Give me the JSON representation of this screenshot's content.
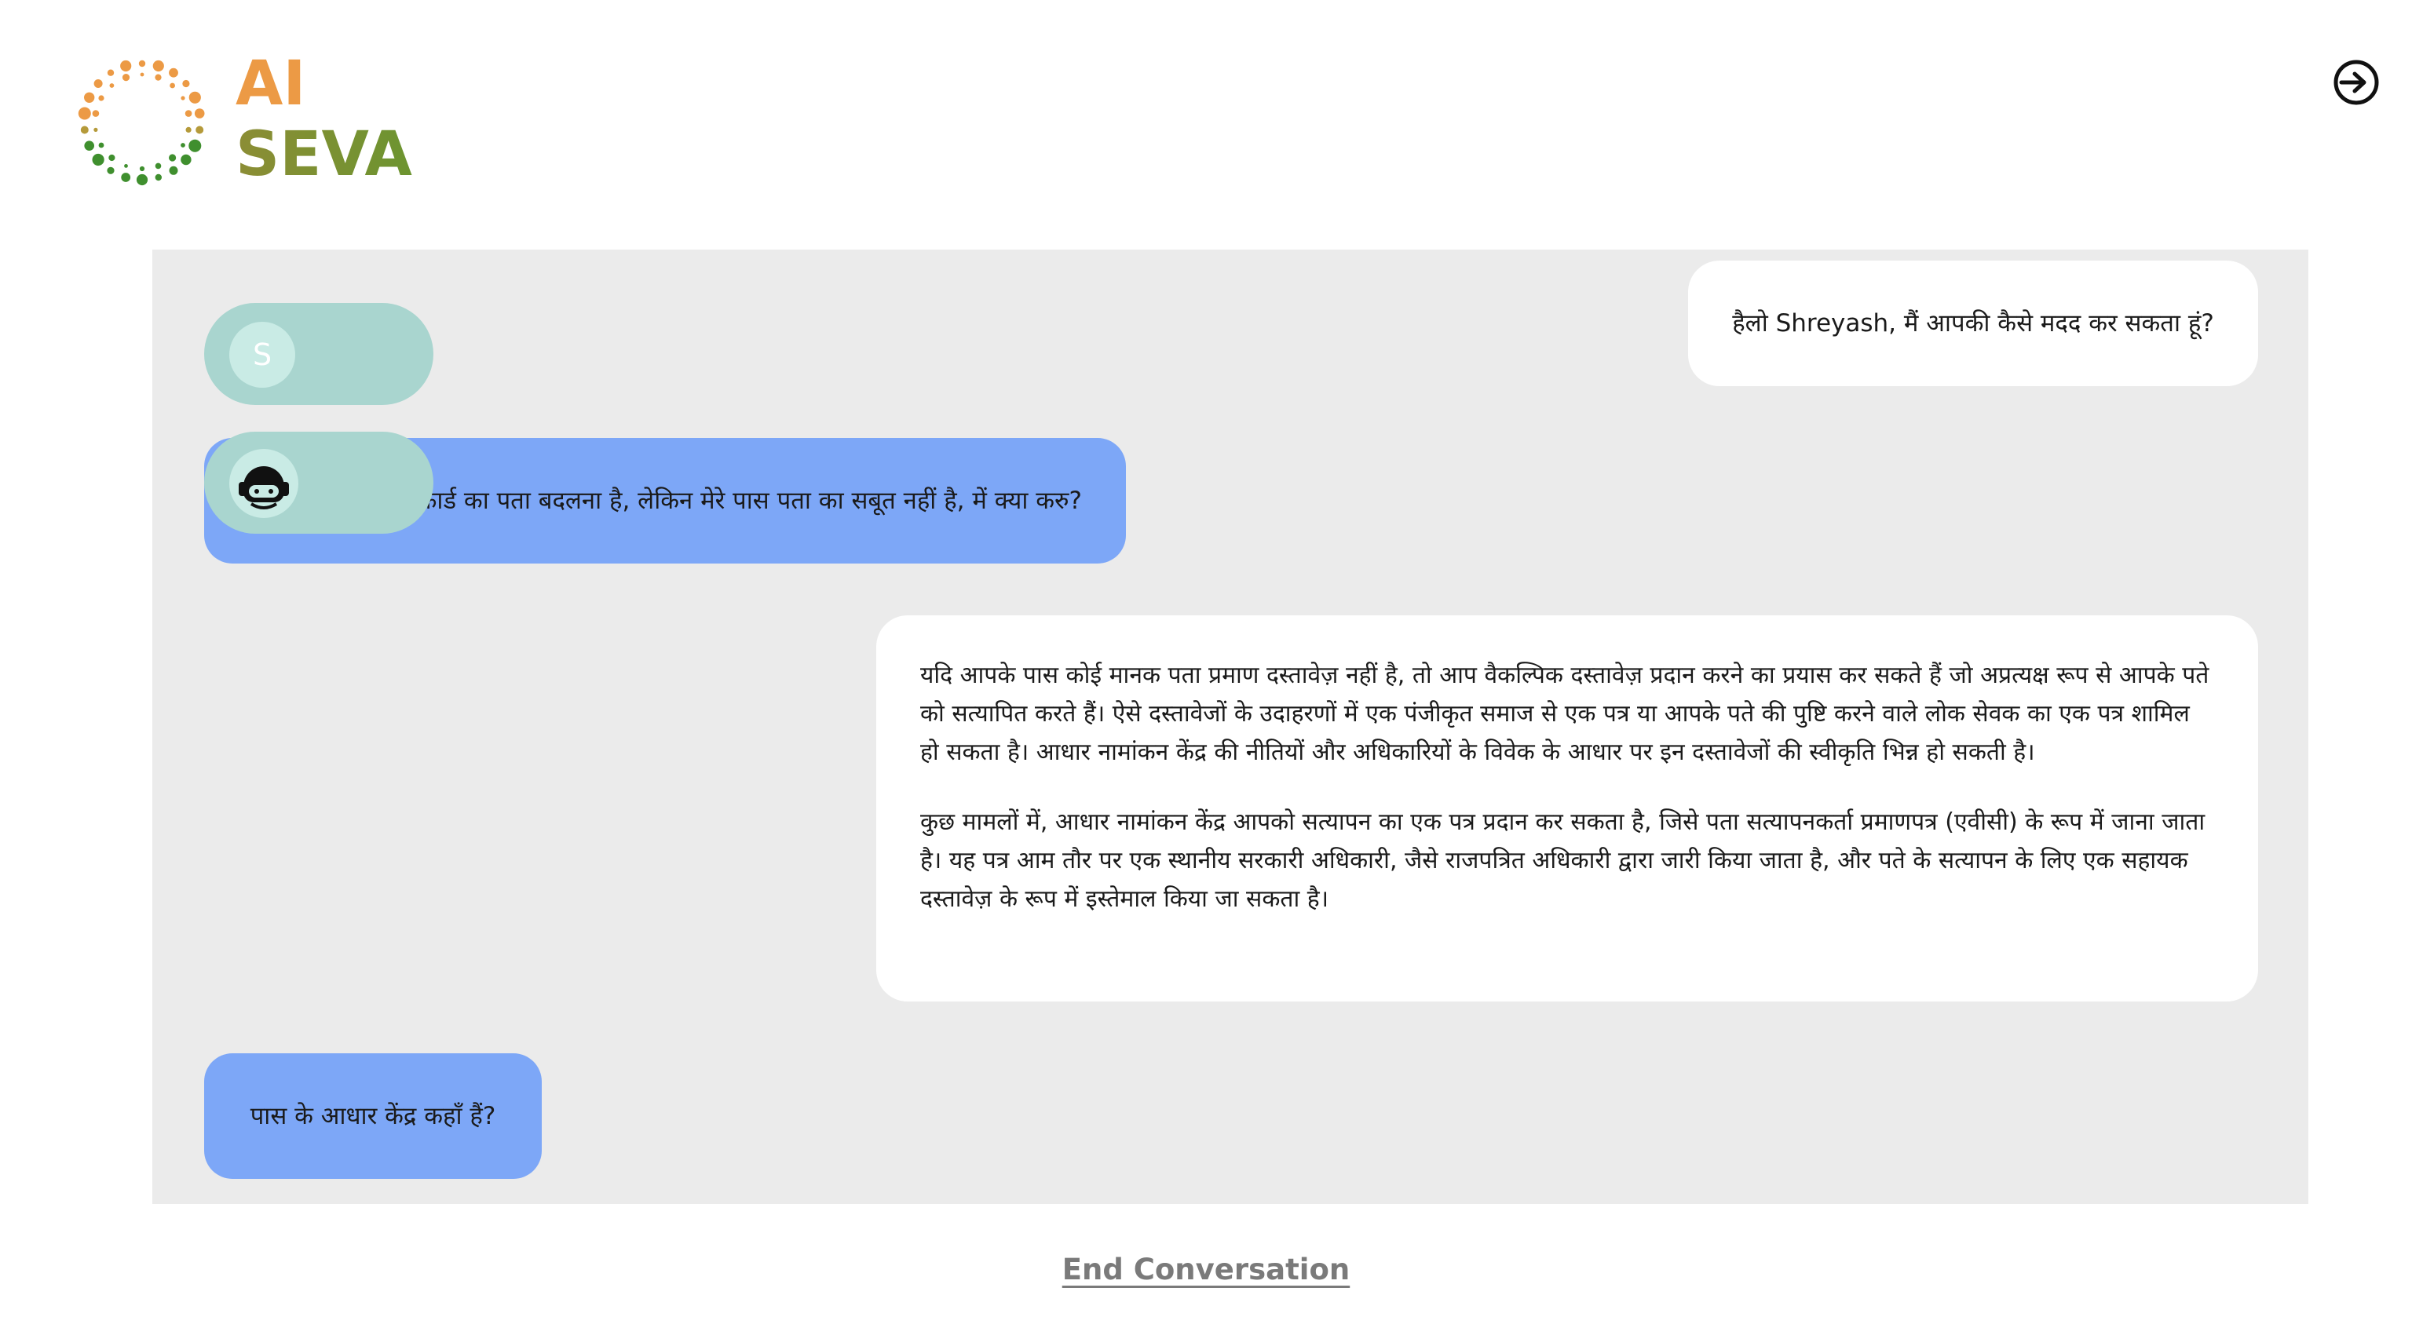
{
  "brand": {
    "line1": "AI",
    "line2": "SEVA",
    "color_line1": "#ec9a45",
    "color_line2": "#7a9133"
  },
  "header": {
    "logout_icon": "logout-arrow-icon"
  },
  "chat": {
    "background": "#ebebeb",
    "user_avatar_letter": "S",
    "messages": [
      {
        "role": "bot",
        "text": "हैलो Shreyash, मैं आपकी कैसे मदद कर सकता हूं?"
      },
      {
        "role": "user",
        "text": "मुझे अपने आधार कार्ड का पता बदलना है, लेकिन मेरे पास पता का सबूत नहीं है, में क्या करु?"
      },
      {
        "role": "bot",
        "paragraphs": [
          "यदि आपके पास कोई मानक पता प्रमाण दस्तावेज़ नहीं है, तो आप वैकल्पिक दस्तावेज़ प्रदान करने का प्रयास कर सकते हैं जो अप्रत्यक्ष रूप से आपके पते को सत्यापित करते हैं। ऐसे दस्तावेजों के उदाहरणों में एक पंजीकृत समाज से एक पत्र या आपके पते की पुष्टि करने वाले लोक सेवक का एक पत्र शामिल हो सकता है। आधार नामांकन केंद्र की नीतियों और अधिकारियों के विवेक के आधार पर इन दस्तावेजों की स्वीकृति भिन्न हो सकती है।",
          "कुछ मामलों में, आधार नामांकन केंद्र आपको सत्यापन का एक पत्र प्रदान कर सकता है, जिसे पता सत्यापनकर्ता प्रमाणपत्र (एवीसी) के रूप में जाना जाता है। यह पत्र आम तौर पर एक स्थानीय सरकारी अधिकारी, जैसे राजपत्रित अधिकारी द्वारा जारी किया जाता है, और पते के सत्यापन के लिए एक सहायक दस्तावेज़ के रूप में इस्तेमाल किया जा सकता है।"
        ]
      },
      {
        "role": "user",
        "text": "पास के आधार केंद्र कहाँ हैं?"
      }
    ]
  },
  "footer": {
    "end_label": "End Conversation"
  },
  "colors": {
    "user_bubble": "#7da7f7",
    "bot_bubble": "#ffffff",
    "avatar_pill": "#a9d5cf"
  }
}
